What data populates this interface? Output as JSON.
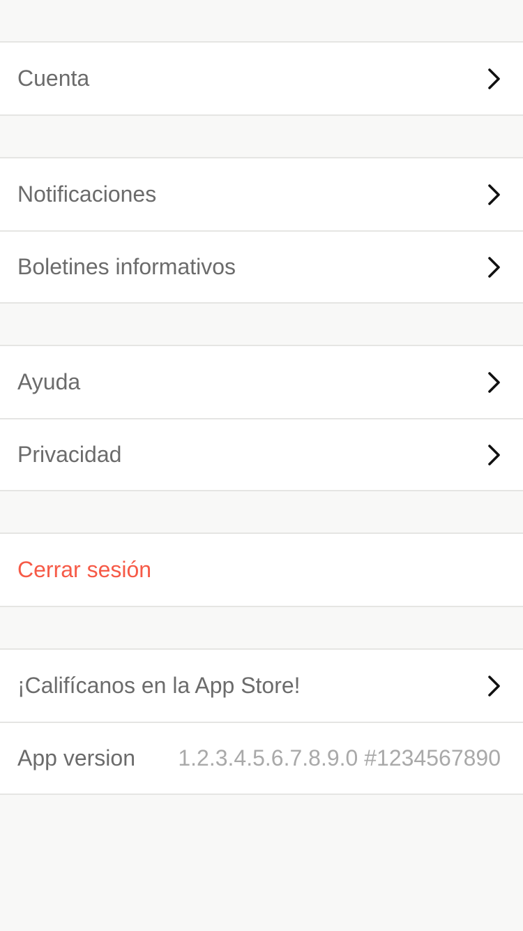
{
  "settings": {
    "account": {
      "label": "Cuenta",
      "icon": "chevron-right-icon"
    },
    "notifications": {
      "label": "Notificaciones",
      "icon": "chevron-right-icon"
    },
    "newsletters": {
      "label": "Boletines informativos",
      "icon": "chevron-right-icon"
    },
    "help": {
      "label": "Ayuda",
      "icon": "chevron-right-icon"
    },
    "privacy": {
      "label": "Privacidad",
      "icon": "chevron-right-icon"
    },
    "logout": {
      "label": "Cerrar sesión",
      "color": "#f65a47"
    },
    "rate": {
      "label": "¡Califícanos en la App Store!",
      "icon": "chevron-right-icon"
    },
    "version": {
      "label": "App version",
      "value": "1.2.3.4.5.6.7.8.9.0 #1234567890"
    }
  },
  "colors": {
    "background": "#f8f8f7",
    "row_background": "#ffffff",
    "separator": "#e5e5e3",
    "label_text": "#6b6b6b",
    "value_text": "#a9a9a9",
    "danger": "#f65a47"
  }
}
